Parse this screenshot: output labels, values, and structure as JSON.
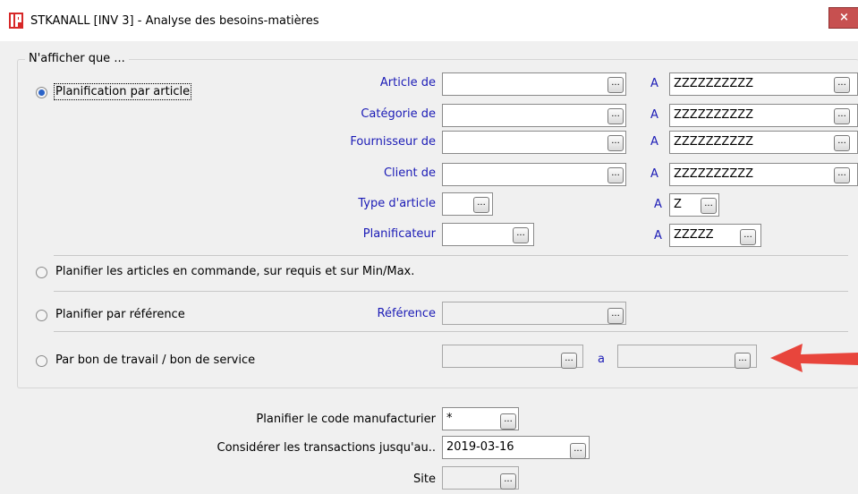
{
  "window": {
    "title": "STKANALL [INV 3] - Analyse des besoins-matières",
    "close_glyph": "×",
    "app_icon_glyph": "P"
  },
  "group": {
    "title": "N'afficher que ..."
  },
  "options": {
    "par_article": "Planification par article",
    "en_commande": "Planifier les articles en commande, sur requis et sur Min/Max.",
    "par_reference": "Planifier par référence",
    "par_bon": "Par bon de travail / bon de service"
  },
  "filters": {
    "article_de": "Article de",
    "categorie_de": "Catégorie de",
    "fournisseur_de": "Fournisseur de",
    "client_de": "Client de",
    "type_article": "Type d'article",
    "planificateur": "Planificateur",
    "a_label": "A",
    "article_a": "ZZZZZZZZZZ",
    "categorie_a": "ZZZZZZZZZZ",
    "fournisseur_a": "ZZZZZZZZZZ",
    "client_a": "ZZZZZZZZZZ",
    "type_a": "Z",
    "planificateur_a": "ZZZZZ",
    "reference": "Référence",
    "bon_a_label": "a"
  },
  "bottom": {
    "code_manufacturier_label": "Planifier le code manufacturier",
    "code_manufacturier_value": "*",
    "transactions_label": "Considérer les transactions jusqu'au..",
    "transactions_value": "2019-03-16",
    "site_label": "Site"
  },
  "browse_glyph": "...",
  "colors": {
    "label_blue": "#1b1bb6",
    "arrow_red": "#e8453c",
    "radio_selected": "#2a63c8"
  }
}
